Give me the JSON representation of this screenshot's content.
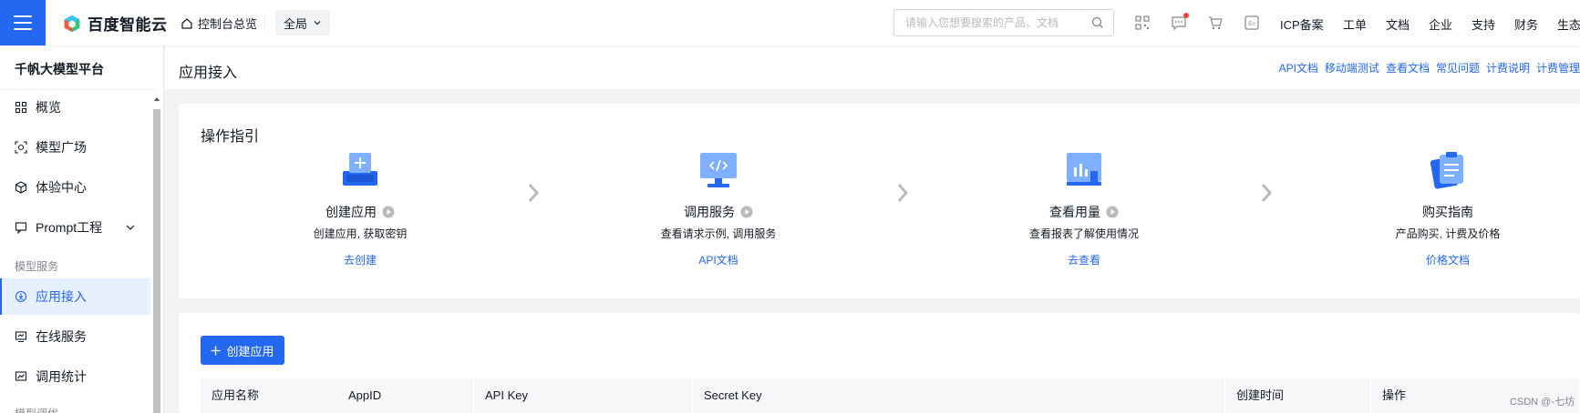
{
  "topbar": {
    "logo_text": "百度智能云",
    "console_home": "控制台总览",
    "region": "全局",
    "search_placeholder": "请输入您想要搜索的产品、文档",
    "links": [
      "ICP备案",
      "工单",
      "文档",
      "企业",
      "支持",
      "财务",
      "生态"
    ]
  },
  "sidebar": {
    "title": "千帆大模型平台",
    "items": [
      {
        "label": "概览",
        "icon": "grid-icon"
      },
      {
        "label": "模型广场",
        "icon": "model-icon"
      },
      {
        "label": "体验中心",
        "icon": "cube-icon"
      },
      {
        "label": "Prompt工程",
        "icon": "prompt-icon"
      }
    ],
    "group_label": "模型服务",
    "service_items": [
      {
        "label": "应用接入",
        "icon": "app-access-icon",
        "active": true
      },
      {
        "label": "在线服务",
        "icon": "online-service-icon"
      },
      {
        "label": "调用统计",
        "icon": "stats-icon"
      }
    ],
    "group_label_2": "模型调优"
  },
  "main": {
    "title": "应用接入",
    "header_links": [
      "API文档",
      "移动端测试",
      "查看文档",
      "常见问题",
      "计费说明",
      "计费管理"
    ],
    "guide": {
      "title": "操作指引",
      "steps": [
        {
          "name": "创建应用",
          "desc": "创建应用, 获取密钥",
          "link": "去创建",
          "play": true
        },
        {
          "name": "调用服务",
          "desc": "查看请求示例, 调用服务",
          "link": "API文档",
          "play": true
        },
        {
          "name": "查看用量",
          "desc": "查看报表了解使用情况",
          "link": "去查看",
          "play": true
        },
        {
          "name": "购买指南",
          "desc": "产品购买, 计费及价格",
          "link": "价格文档",
          "play": false
        }
      ]
    },
    "create_button": "创建应用",
    "table": {
      "columns": [
        "应用名称",
        "AppID",
        "API Key",
        "Secret Key",
        "创建时间",
        "操作"
      ]
    }
  },
  "watermark": "CSDN @-七坊",
  "colors": {
    "primary": "#2468f2",
    "notification": "#f33e3e",
    "active_bg": "#e6f0ff"
  }
}
